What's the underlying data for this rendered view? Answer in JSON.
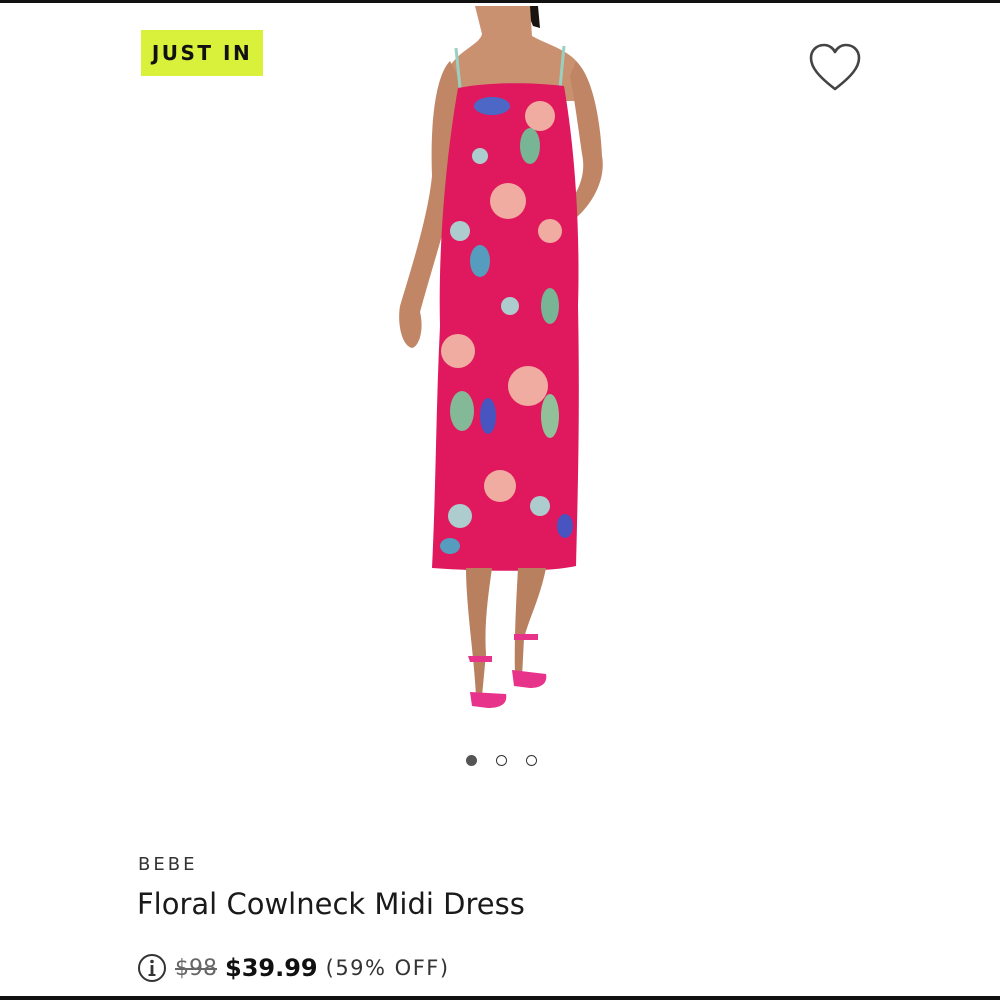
{
  "badge": {
    "label": "JUST IN",
    "color": "#d9f13a"
  },
  "wishlist": {
    "icon": "heart-icon"
  },
  "product_image": {
    "subject": "model wearing pink floral midi dress with pink heeled sandals",
    "dress_color": "#e0185e",
    "carousel_count": 3,
    "carousel_active_index": 0
  },
  "product": {
    "brand": "BEBE",
    "title": "Floral Cowlneck Midi Dress",
    "original_price": "$98",
    "sale_price": "$39.99",
    "discount": "(59% OFF)",
    "info_icon": "info-icon"
  }
}
